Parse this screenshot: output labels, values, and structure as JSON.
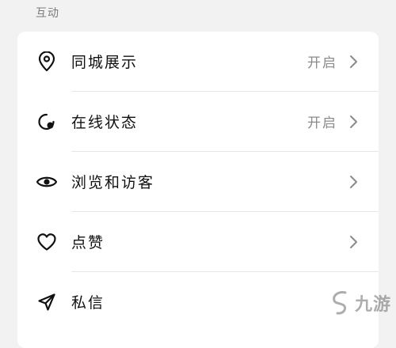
{
  "section": {
    "title": "互动"
  },
  "rows": [
    {
      "label": "同城展示",
      "value": "开启",
      "icon": "location-pin-icon"
    },
    {
      "label": "在线状态",
      "value": "开启",
      "icon": "online-status-icon"
    },
    {
      "label": "浏览和访客",
      "value": "",
      "icon": "eye-icon"
    },
    {
      "label": "点赞",
      "value": "",
      "icon": "heart-icon"
    },
    {
      "label": "私信",
      "value": "",
      "icon": "send-icon"
    }
  ],
  "watermark": {
    "text": "九游"
  }
}
